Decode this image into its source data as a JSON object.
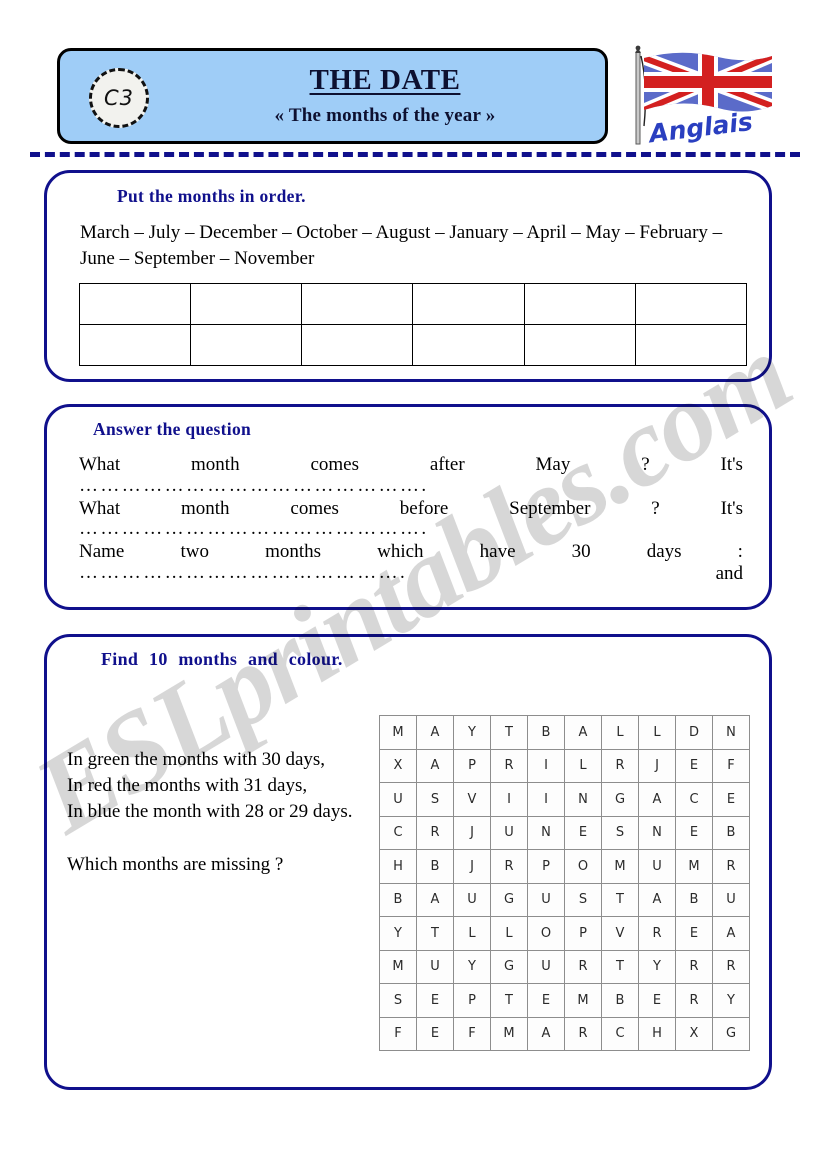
{
  "watermark": "ESLprintables.com",
  "header": {
    "code": "C3",
    "title": "THE DATE",
    "subtitle": "« The months of the year »",
    "flag_label": "Anglais",
    "flag_icon": "union-jack-flag-icon"
  },
  "section_order": {
    "heading": "Put the months in order.",
    "months_line": "March – July – December – October – August – January – April – May – February – June – September – November",
    "table": {
      "columns": 6,
      "rows": 2,
      "cells": [
        [
          "",
          "",
          "",
          "",
          "",
          ""
        ],
        [
          "",
          "",
          "",
          "",
          "",
          ""
        ]
      ]
    }
  },
  "section_answer": {
    "heading": "Answer the question",
    "questions": [
      {
        "words": [
          "What",
          "month",
          "comes",
          "after",
          "May",
          "?",
          "It's"
        ],
        "dots": "…………………………………………."
      },
      {
        "words": [
          "What",
          "month",
          "comes",
          "before",
          "September",
          "?",
          "It's"
        ],
        "dots": "…………………………………………."
      },
      {
        "words": [
          "Name",
          "two",
          "months",
          "which",
          "have",
          "30",
          "days",
          ":"
        ],
        "dots": "……………………………………….",
        "trailing": "and"
      }
    ]
  },
  "section_find": {
    "heading": "Find  10  months  and  colour.",
    "instructions": [
      "In green the months with 30 days,",
      "In red the months with 31 days,",
      "In blue the month with 28 or 29 days."
    ],
    "missing_question": "Which months are missing ?",
    "wordsearch": {
      "rows": 10,
      "columns": 10,
      "grid": [
        [
          "M",
          "A",
          "Y",
          "T",
          "B",
          "A",
          "L",
          "L",
          "D",
          "N"
        ],
        [
          "X",
          "A",
          "P",
          "R",
          "I",
          "L",
          "R",
          "J",
          "E",
          "F"
        ],
        [
          "U",
          "S",
          "V",
          "I",
          "I",
          "N",
          "G",
          "A",
          "C",
          "E"
        ],
        [
          "C",
          "R",
          "J",
          "U",
          "N",
          "E",
          "S",
          "N",
          "E",
          "B"
        ],
        [
          "H",
          "B",
          "J",
          "R",
          "P",
          "O",
          "M",
          "U",
          "M",
          "R"
        ],
        [
          "B",
          "A",
          "U",
          "G",
          "U",
          "S",
          "T",
          "A",
          "B",
          "U"
        ],
        [
          "Y",
          "T",
          "L",
          "L",
          "O",
          "P",
          "V",
          "R",
          "E",
          "A"
        ],
        [
          "M",
          "U",
          "Y",
          "G",
          "U",
          "R",
          "T",
          "Y",
          "R",
          "R"
        ],
        [
          "S",
          "E",
          "P",
          "T",
          "E",
          "M",
          "B",
          "E",
          "R",
          "Y"
        ],
        [
          "F",
          "E",
          "F",
          "M",
          "A",
          "R",
          "C",
          "H",
          "X",
          "G"
        ]
      ]
    }
  },
  "colors": {
    "header_fill": "#9fcdf7",
    "accent_blue": "#10108c",
    "flag_red": "#d32020",
    "flag_blue": "#4d5ec4"
  }
}
